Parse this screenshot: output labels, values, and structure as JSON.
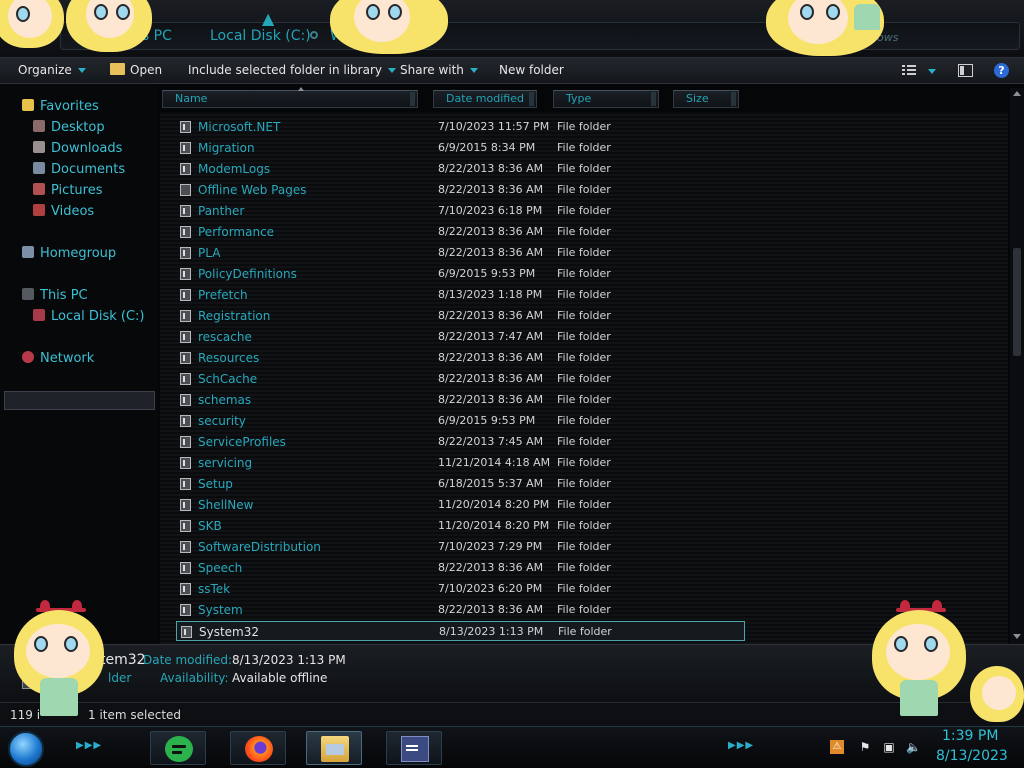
{
  "address": {
    "crumbs": [
      "is PC",
      "Local Disk (C:)",
      "W"
    ],
    "search_hint": "dows"
  },
  "toolbar": {
    "organize": "Organize",
    "open": "Open",
    "include": "Include selected folder in library",
    "share": "Share with",
    "new_folder": "New folder",
    "help": "?"
  },
  "nav": {
    "favorites": "Favorites",
    "desktop": "Desktop",
    "downloads": "Downloads",
    "documents": "Documents",
    "pictures": "Pictures",
    "videos": "Videos",
    "homegroup": "Homegroup",
    "this_pc": "This PC",
    "local_disk": "Local Disk (C:)",
    "network": "Network"
  },
  "columns": {
    "name": "Name",
    "date": "Date modified",
    "type": "Type",
    "size": "Size"
  },
  "files": [
    {
      "name": "Microsoft.NET",
      "date": "7/10/2023 11:57 PM",
      "type": "File folder"
    },
    {
      "name": "Migration",
      "date": "6/9/2015 8:34 PM",
      "type": "File folder"
    },
    {
      "name": "ModemLogs",
      "date": "8/22/2013 8:36 AM",
      "type": "File folder"
    },
    {
      "name": "Offline Web Pages",
      "date": "8/22/2013 8:36 AM",
      "type": "File folder"
    },
    {
      "name": "Panther",
      "date": "7/10/2023 6:18 PM",
      "type": "File folder"
    },
    {
      "name": "Performance",
      "date": "8/22/2013 8:36 AM",
      "type": "File folder"
    },
    {
      "name": "PLA",
      "date": "8/22/2013 8:36 AM",
      "type": "File folder"
    },
    {
      "name": "PolicyDefinitions",
      "date": "6/9/2015 9:53 PM",
      "type": "File folder"
    },
    {
      "name": "Prefetch",
      "date": "8/13/2023 1:18 PM",
      "type": "File folder"
    },
    {
      "name": "Registration",
      "date": "8/22/2013 8:36 AM",
      "type": "File folder"
    },
    {
      "name": "rescache",
      "date": "8/22/2013 7:47 AM",
      "type": "File folder"
    },
    {
      "name": "Resources",
      "date": "8/22/2013 8:36 AM",
      "type": "File folder"
    },
    {
      "name": "SchCache",
      "date": "8/22/2013 8:36 AM",
      "type": "File folder"
    },
    {
      "name": "schemas",
      "date": "8/22/2013 8:36 AM",
      "type": "File folder"
    },
    {
      "name": "security",
      "date": "6/9/2015 9:53 PM",
      "type": "File folder"
    },
    {
      "name": "ServiceProfiles",
      "date": "8/22/2013 7:45 AM",
      "type": "File folder"
    },
    {
      "name": "servicing",
      "date": "11/21/2014 4:18 AM",
      "type": "File folder"
    },
    {
      "name": "Setup",
      "date": "6/18/2015 5:37 AM",
      "type": "File folder"
    },
    {
      "name": "ShellNew",
      "date": "11/20/2014 8:20 PM",
      "type": "File folder"
    },
    {
      "name": "SKB",
      "date": "11/20/2014 8:20 PM",
      "type": "File folder"
    },
    {
      "name": "SoftwareDistribution",
      "date": "7/10/2023 7:29 PM",
      "type": "File folder"
    },
    {
      "name": "Speech",
      "date": "8/22/2013 8:36 AM",
      "type": "File folder"
    },
    {
      "name": "ssTek",
      "date": "7/10/2023 6:20 PM",
      "type": "File folder"
    },
    {
      "name": "System",
      "date": "8/22/2013 8:36 AM",
      "type": "File folder"
    },
    {
      "name": "System32",
      "date": "8/13/2023 1:13 PM",
      "type": "File folder"
    }
  ],
  "details": {
    "name": "tem32",
    "type": "lder",
    "date_label": "Date modified:",
    "date_value": "8/13/2023 1:13 PM",
    "avail_label": "Availability:",
    "avail_value": "Available offline"
  },
  "status": {
    "items": "119 i",
    "selected": "1 item selected"
  },
  "clock": {
    "time": "1:39 PM",
    "date": "8/13/2023"
  },
  "colors": {
    "accent": "#21a3b6",
    "background": "#0a0b0d",
    "selection_border": "#4aa6a8"
  }
}
